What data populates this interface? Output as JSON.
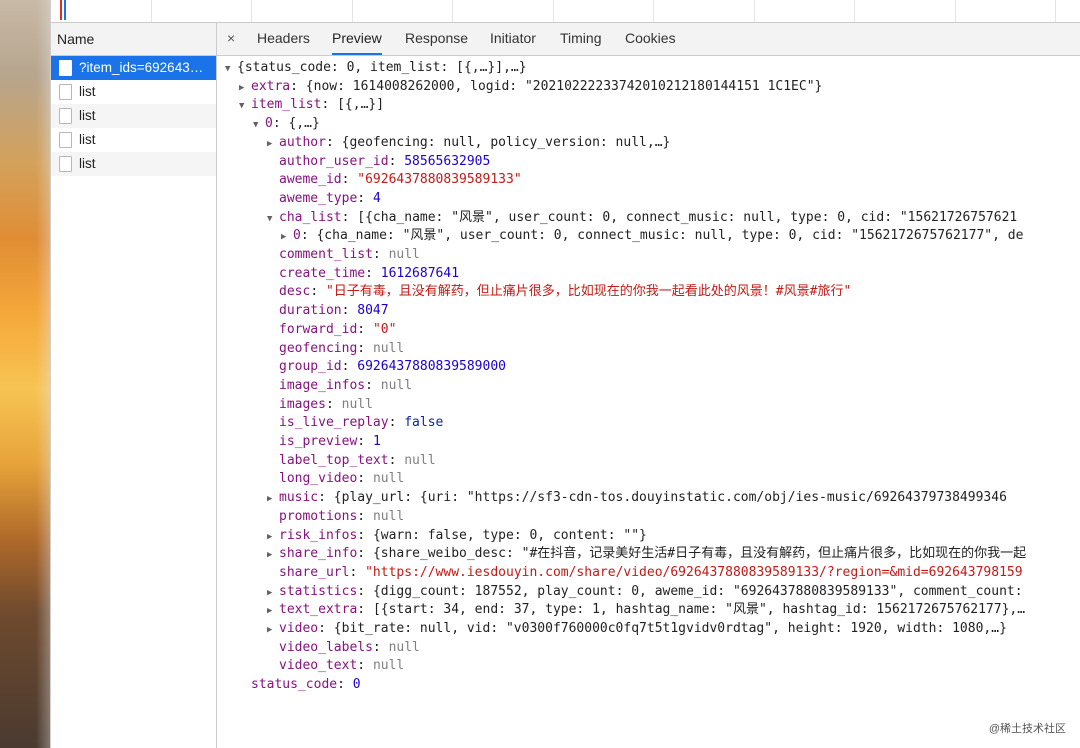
{
  "devtools": {
    "name_header": "Name",
    "requests": [
      {
        "label": "?item_ids=692643…",
        "selected": true
      },
      {
        "label": "list"
      },
      {
        "label": "list"
      },
      {
        "label": "list"
      },
      {
        "label": "list"
      }
    ],
    "tabs": [
      "Headers",
      "Preview",
      "Response",
      "Initiator",
      "Timing",
      "Cookies"
    ],
    "active_tab": "Preview",
    "close_symbol": "×"
  },
  "preview": {
    "root": "{status_code: 0, item_list: [{,…}],…}",
    "extra_key": "extra",
    "extra_val": "{now: 1614008262000, logid: \"20210222233742010212180144151 1C1EC\"}",
    "item_list_key": "item_list",
    "item_list_val": "[{,…}]",
    "item0_key": "0",
    "item0_val": "{,…}",
    "author_key": "author",
    "author_val": "{geofencing: null, policy_version: null,…}",
    "author_user_id_key": "author_user_id",
    "author_user_id_val": "58565632905",
    "aweme_id_key": "aweme_id",
    "aweme_id_val": "\"6926437880839589133\"",
    "aweme_type_key": "aweme_type",
    "aweme_type_val": "4",
    "cha_list_key": "cha_list",
    "cha_list_val": "[{cha_name: \"风景\", user_count: 0, connect_music: null, type: 0, cid: \"15621726757621",
    "cha0_key": "0",
    "cha0_val": "{cha_name: \"风景\", user_count: 0, connect_music: null, type: 0, cid: \"1562172675762177\", de",
    "comment_list_key": "comment_list",
    "create_time_key": "create_time",
    "create_time_val": "1612687641",
    "desc_key": "desc",
    "desc_val": "\"日子有毒，且没有解药，但止痛片很多，比如现在的你我一起看此处的风景！#风景#旅行\"",
    "duration_key": "duration",
    "duration_val": "8047",
    "forward_id_key": "forward_id",
    "forward_id_val": "\"0\"",
    "geofencing_key": "geofencing",
    "group_id_key": "group_id",
    "group_id_val": "6926437880839589000",
    "image_infos_key": "image_infos",
    "images_key": "images",
    "is_live_replay_key": "is_live_replay",
    "is_live_replay_val": "false",
    "is_preview_key": "is_preview",
    "is_preview_val": "1",
    "label_top_text_key": "label_top_text",
    "long_video_key": "long_video",
    "music_key": "music",
    "music_val": "{play_url: {uri: \"https://sf3-cdn-tos.douyinstatic.com/obj/ies-music/69264379738499346",
    "promotions_key": "promotions",
    "risk_infos_key": "risk_infos",
    "risk_infos_val": "{warn: false, type: 0, content: \"\"}",
    "share_info_key": "share_info",
    "share_info_val": "{share_weibo_desc: \"#在抖音，记录美好生活#日子有毒，且没有解药，但止痛片很多，比如现在的你我一起",
    "share_url_key": "share_url",
    "share_url_val": "\"https://www.iesdouyin.com/share/video/6926437880839589133/?region=&mid=692643798159",
    "statistics_key": "statistics",
    "statistics_val": "{digg_count: 187552, play_count: 0, aweme_id: \"6926437880839589133\", comment_count:",
    "text_extra_key": "text_extra",
    "text_extra_val": "[{start: 34, end: 37, type: 1, hashtag_name: \"风景\", hashtag_id: 1562172675762177},…",
    "video_key": "video",
    "video_val": "{bit_rate: null, vid: \"v0300f760000c0fq7t5t1gvidv0rdtag\", height: 1920, width: 1080,…}",
    "video_labels_key": "video_labels",
    "video_text_key": "video_text",
    "status_code_key": "status_code",
    "status_code_val": "0",
    "null_text": "null"
  },
  "watermark": "@稀土技术社区"
}
